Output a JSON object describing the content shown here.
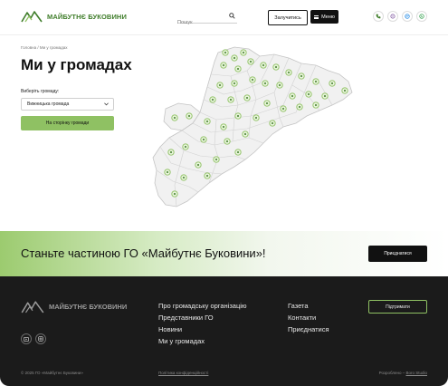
{
  "header": {
    "logo_text": "МАЙБУТНЄ БУКОВИНИ",
    "search_placeholder": "Пошук",
    "join_label": "Залучитись",
    "menu_label": "Меню",
    "socials": [
      "phone-icon",
      "viber-icon",
      "messenger-icon",
      "whatsapp-icon"
    ]
  },
  "hero": {
    "breadcrumb": "Головна / Ми у громадах",
    "title": "Ми у громадах",
    "select_label": "Виберіть громаду:",
    "select_value": "Вижницька громада",
    "go_button": "На сторінку громади"
  },
  "cta": {
    "text": "Станьте частиною ГО «Майбутнє Буковини»!",
    "button": "Приєднатися"
  },
  "footer": {
    "logo_text": "МАЙБУТНЄ БУКОВИНИ",
    "socials": [
      "youtube-icon",
      "instagram-icon"
    ],
    "col1": [
      "Про громадську організацію",
      "Представники ГО",
      "Новини",
      "Ми у громадах"
    ],
    "col2": [
      "Газета",
      "Контакти",
      "Приєднатися"
    ],
    "support_button": "Підтримати",
    "copyright": "© 2025 ГО «Майбутнє Буковини»",
    "policy": "Політика конфіденційності",
    "dev_prefix": "Розроблено – ",
    "dev_name": "Boro Studio"
  },
  "colors": {
    "brand_green": "#3f7d2a",
    "accent_green": "#8fc163",
    "footer_bg": "#1b1b1b"
  }
}
